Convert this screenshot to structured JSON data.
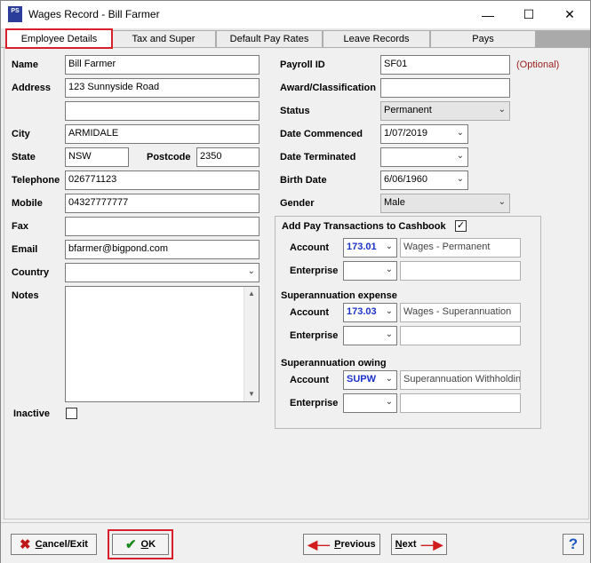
{
  "window": {
    "title": "Wages Record - Bill Farmer",
    "app_icon_text": "PS",
    "minimize_glyph": "—",
    "maximize_glyph": "☐",
    "close_glyph": "✕"
  },
  "tabs": [
    {
      "label": "Employee Details",
      "active": true
    },
    {
      "label": "Tax and Super",
      "active": false
    },
    {
      "label": "Default Pay Rates",
      "active": false
    },
    {
      "label": "Leave Records",
      "active": false
    },
    {
      "label": "Pays",
      "active": false
    }
  ],
  "left": {
    "name": {
      "label": "Name",
      "value": "Bill Farmer"
    },
    "address": {
      "label": "Address",
      "line1": "123 Sunnyside Road",
      "line2": ""
    },
    "city": {
      "label": "City",
      "value": "ARMIDALE"
    },
    "state": {
      "label": "State",
      "value": "NSW"
    },
    "postcode": {
      "label": "Postcode",
      "value": "2350"
    },
    "telephone": {
      "label": "Telephone",
      "value": "026771123"
    },
    "mobile": {
      "label": "Mobile",
      "value": "04327777777"
    },
    "fax": {
      "label": "Fax",
      "value": ""
    },
    "email": {
      "label": "Email",
      "value": "bfarmer@bigpond.com"
    },
    "country": {
      "label": "Country",
      "value": ""
    },
    "notes": {
      "label": "Notes",
      "value": ""
    },
    "inactive": {
      "label": "Inactive",
      "checked": false
    }
  },
  "right": {
    "payroll_id": {
      "label": "Payroll ID",
      "value": "SF01",
      "hint": "(Optional)"
    },
    "award": {
      "label": "Award/Classification",
      "value": ""
    },
    "status": {
      "label": "Status",
      "value": "Permanent"
    },
    "date_commenced": {
      "label": "Date Commenced",
      "value": "1/07/2019"
    },
    "date_terminated": {
      "label": "Date Terminated",
      "value": ""
    },
    "birth_date": {
      "label": "Birth Date",
      "value": "6/06/1960"
    },
    "gender": {
      "label": "Gender",
      "value": "Male"
    }
  },
  "cashbook": {
    "title": "Add Pay Transactions to Cashbook",
    "checked": true,
    "check_glyph": "✓",
    "account_label": "Account",
    "enterprise_label": "Enterprise",
    "wages": {
      "account_code": "173.01",
      "account_name": "Wages - Permanent",
      "enterprise": "",
      "enterprise_name": ""
    },
    "super_expense": {
      "heading": "Superannuation expense",
      "account_code": "173.03",
      "account_name": "Wages - Superannuation",
      "enterprise": "",
      "enterprise_name": ""
    },
    "super_owing": {
      "heading": "Superannuation owing",
      "account_code": "SUPW",
      "account_name": "Superannuation Withholding",
      "enterprise": "",
      "enterprise_name": ""
    }
  },
  "footer": {
    "cancel": {
      "label": "Cancel/Exit",
      "mnemonic": "C",
      "rest": "ancel/Exit"
    },
    "ok": {
      "label": "OK",
      "mnemonic": "O",
      "rest": "K"
    },
    "previous": {
      "label": "Previous",
      "mnemonic": "P",
      "rest": "revious"
    },
    "next": {
      "label": "Next",
      "mnemonic": "N",
      "rest": "ext"
    },
    "help_glyph": "?"
  },
  "colors": {
    "active_tab_border": "#d9202a",
    "account_code": "#1c33c8",
    "optional_hint": "#9b1c1c",
    "help_icon": "#1f58c5"
  }
}
